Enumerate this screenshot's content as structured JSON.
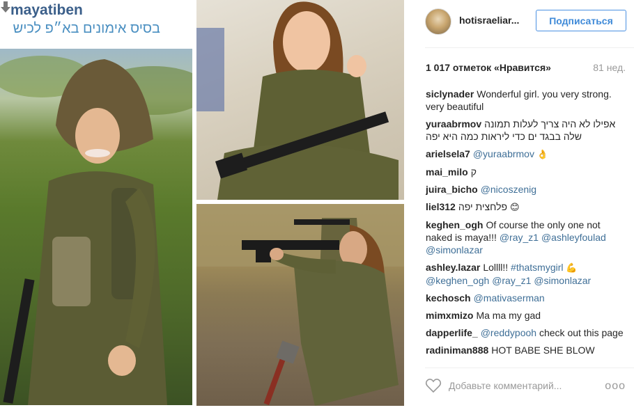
{
  "collage": {
    "overlay_username": "mayatiben",
    "overlay_caption": "בסיס אימונים בא״פ לכיש"
  },
  "post_header": {
    "account": "hotisraeliar...",
    "follow_label": "Подписаться"
  },
  "stats": {
    "likes": "1 017 отметок «Нравится»",
    "age": "81 нед."
  },
  "comments": [
    {
      "user": "siclynader",
      "text": "Wonderful girl. you very strong. very beautiful"
    },
    {
      "user": "yuraabrmov",
      "text": "אפילו לא היה צריך לעלות תמונה שלה בבגד ים כדי ליראות כמה היא יפה"
    },
    {
      "user": "arielsela7",
      "mention": "@yuraabrmov",
      "emoji": "👌"
    },
    {
      "user": "mai_milo",
      "text": "ק"
    },
    {
      "user": "juira_bicho",
      "mention": "@nicoszenig"
    },
    {
      "user": "liel312",
      "text": "פלחצית יפה",
      "emoji": "😊"
    },
    {
      "user": "keghen_ogh",
      "text": "Of course the only one not naked is maya!!!",
      "mentions": [
        "@ray_z1",
        "@ashleyfoulad",
        "@simonlazar"
      ]
    },
    {
      "user": "ashley.lazar",
      "text": "Lollll!!",
      "hashtag": "#thatsmygirl",
      "emoji": "💪",
      "mentions": [
        "@keghen_ogh",
        "@ray_z1",
        "@simonlazar"
      ]
    },
    {
      "user": "kechosch",
      "mention": "@mativaserman"
    },
    {
      "user": "mimxmizo",
      "text": "Ma ma my gad"
    },
    {
      "user": "dapperlife_",
      "mention": "@reddypooh",
      "text": "check out this page"
    },
    {
      "user": "radiniman888",
      "text": "HOT BABE SHE BLOW"
    }
  ],
  "comment_bar": {
    "placeholder": "Добавьте комментарий...",
    "more": "ooo"
  },
  "colors": {
    "accent": "#3f8ad8",
    "mention": "#3f6f97",
    "muted": "#999999"
  },
  "icons": {
    "heart": "heart-outline-icon",
    "more": "more-options-icon",
    "download": "download-arrow-icon"
  }
}
